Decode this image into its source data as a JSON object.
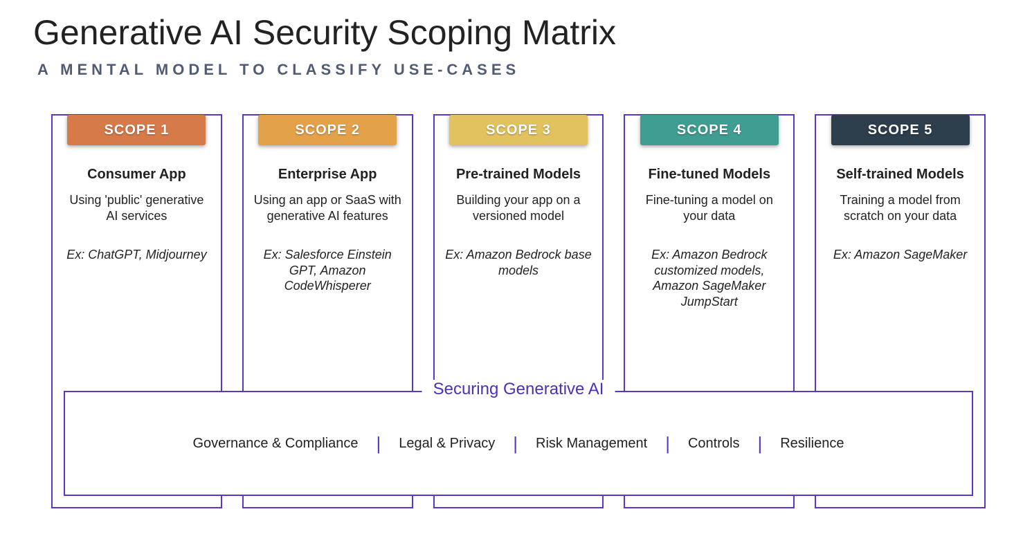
{
  "title": "Generative AI Security Scoping Matrix",
  "subtitle": "A MENTAL MODEL TO CLASSIFY USE-CASES",
  "scopes": [
    {
      "badge": "SCOPE 1",
      "color": "#d77a4a",
      "heading": "Consumer App",
      "desc": "Using 'public' generative AI services",
      "example": "Ex: ChatGPT, Midjourney"
    },
    {
      "badge": "SCOPE 2",
      "color": "#e3a24a",
      "heading": "Enterprise App",
      "desc": "Using an app or SaaS with generative AI features",
      "example": "Ex: Salesforce Einstein GPT, Amazon CodeWhisperer"
    },
    {
      "badge": "SCOPE 3",
      "color": "#e2c25f",
      "heading": "Pre-trained Models",
      "desc": "Building your app on a versioned model",
      "example": "Ex: Amazon Bedrock base models"
    },
    {
      "badge": "SCOPE 4",
      "color": "#3f9d91",
      "heading": "Fine-tuned Models",
      "desc": "Fine-tuning a model on your data",
      "example": "Ex: Amazon Bedrock customized models, Amazon SageMaker JumpStart"
    },
    {
      "badge": "SCOPE 5",
      "color": "#2d3e4d",
      "heading": "Self-trained Models",
      "desc": "Training a model from scratch on your data",
      "example": "Ex: Amazon SageMaker"
    }
  ],
  "securing": {
    "title": "Securing Generative AI",
    "pillars": [
      "Governance & Compliance",
      "Legal & Privacy",
      "Risk Management",
      "Controls",
      "Resilience"
    ]
  }
}
